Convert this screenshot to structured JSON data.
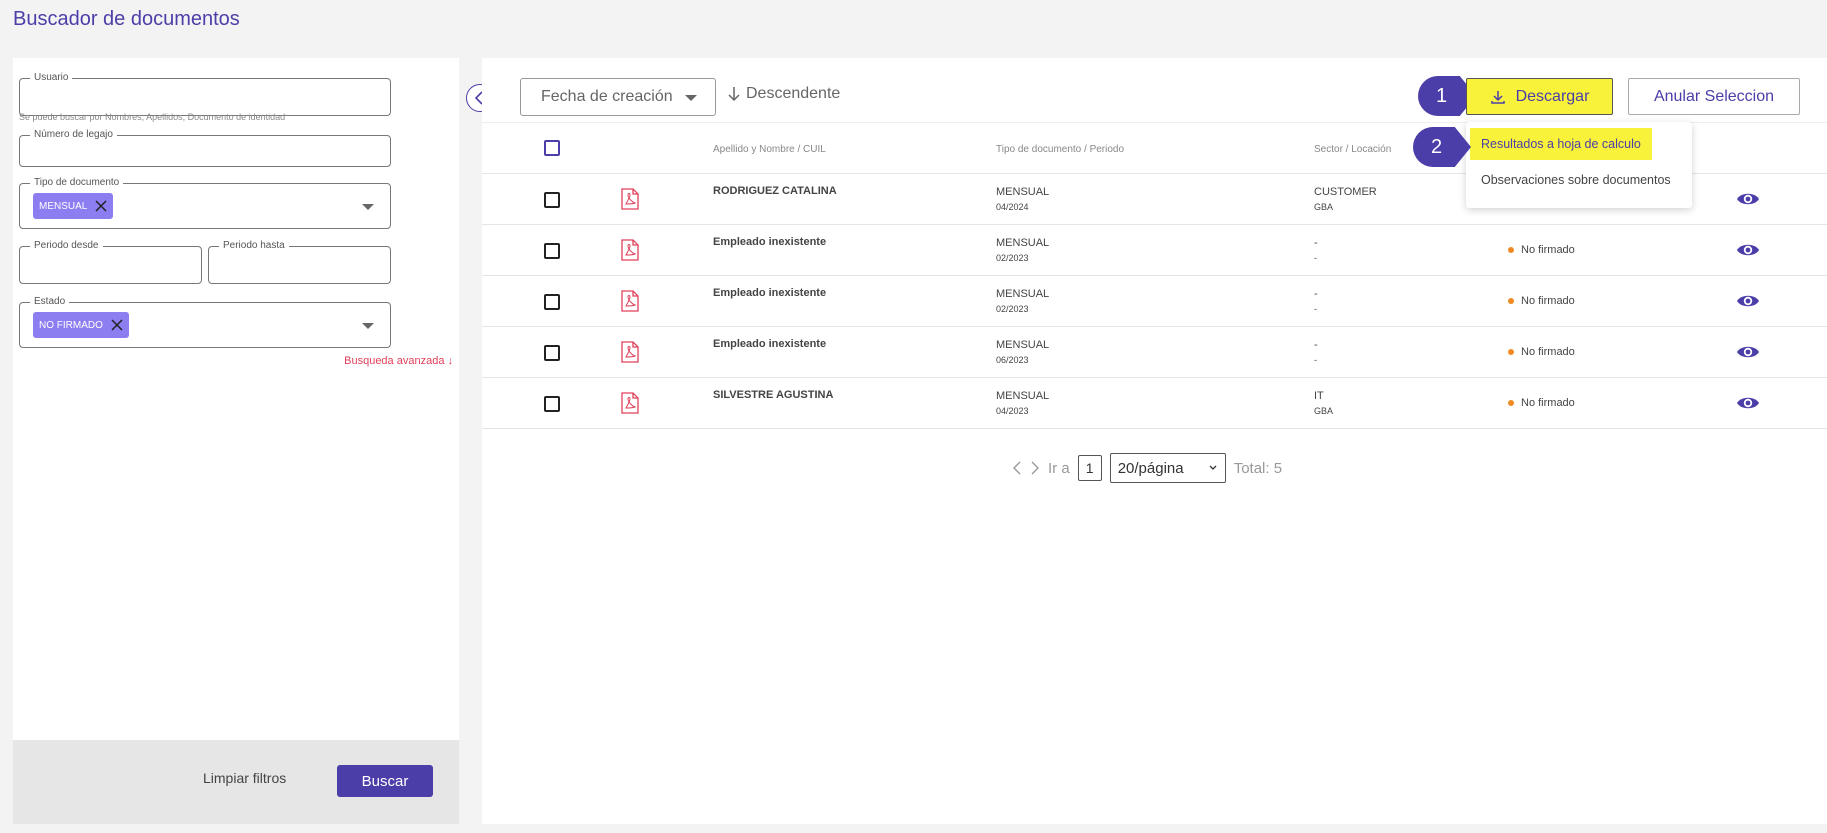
{
  "page_title": "Buscador de documentos",
  "filters": {
    "usuario": {
      "label": "Usuario",
      "value": "",
      "helper": "Se puede buscar por Nombres, Apellidos, Documento de identidad"
    },
    "legajo": {
      "label": "Número de legajo",
      "value": ""
    },
    "tipo_documento": {
      "label": "Tipo de documento",
      "chip": "MENSUAL"
    },
    "periodo_desde": {
      "label": "Periodo desde",
      "value": ""
    },
    "periodo_hasta": {
      "label": "Periodo hasta",
      "value": ""
    },
    "estado": {
      "label": "Estado",
      "chip": "NO FIRMADO"
    },
    "advanced_link": "Busqueda avanzada ↓",
    "clear_label": "Limpiar filtros",
    "search_label": "Buscar"
  },
  "toolbar": {
    "sort_field": "Fecha de creación",
    "sort_order": "Descendente",
    "download_label": "Descargar",
    "unselect_label": "Anular Seleccion",
    "step1": "1",
    "step2": "2"
  },
  "download_menu": {
    "items": [
      "Resultados a hoja de calculo",
      "Observaciones sobre documentos"
    ]
  },
  "table": {
    "headers": [
      "Apellido y Nombre / CUIL",
      "Tipo de documento / Periodo",
      "Sector / Locación"
    ],
    "rows": [
      {
        "name": "RODRIGUEZ CATALINA",
        "type": "MENSUAL",
        "period": "04/2024",
        "sector": "CUSTOMER",
        "location": "GBA",
        "status": ""
      },
      {
        "name": "Empleado inexistente",
        "type": "MENSUAL",
        "period": "02/2023",
        "sector": "-",
        "location": "-",
        "status": "No firmado"
      },
      {
        "name": "Empleado inexistente",
        "type": "MENSUAL",
        "period": "02/2023",
        "sector": "-",
        "location": "-",
        "status": "No firmado"
      },
      {
        "name": "Empleado inexistente",
        "type": "MENSUAL",
        "period": "06/2023",
        "sector": "-",
        "location": "-",
        "status": "No firmado"
      },
      {
        "name": "SILVESTRE AGUSTINA",
        "type": "MENSUAL",
        "period": "04/2023",
        "sector": "IT",
        "location": "GBA",
        "status": "No firmado"
      }
    ]
  },
  "pagination": {
    "goto_label": "Ir a",
    "page": "1",
    "page_size": "20/página",
    "total": "Total: 5"
  },
  "colors": {
    "accent": "#4b3ea8",
    "highlight": "#f8f23a",
    "chip": "#8c7ef0",
    "status_dot": "#f08a24"
  }
}
